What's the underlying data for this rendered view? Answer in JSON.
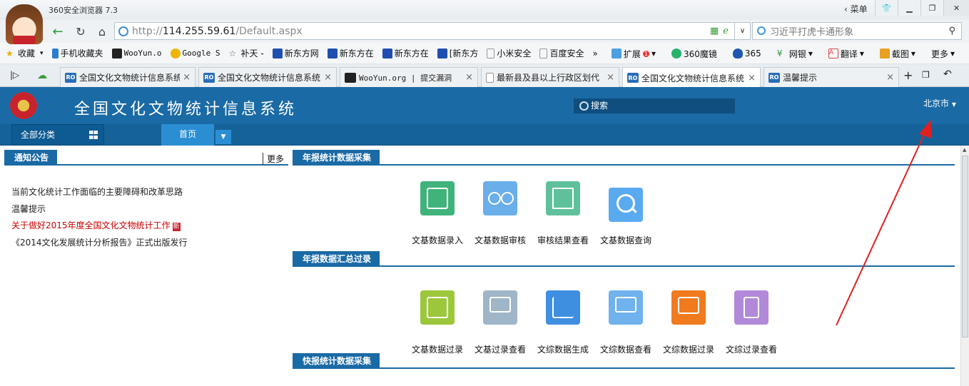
{
  "browser": {
    "app_title": "360安全浏览器 7.3",
    "menu_label": "菜单",
    "url_scheme": "http://",
    "url_host": "114.255.59.61",
    "url_path": "/Default.aspx",
    "search_placeholder": "习近平打虎卡通形象",
    "favorites": [
      {
        "label": "收藏",
        "icon": "star-icon"
      },
      {
        "label": "手机收藏夹",
        "icon": "phone-icon"
      },
      {
        "label": "WooYun.o",
        "icon": "wooyun-icon"
      },
      {
        "label": "Google S",
        "icon": "google-icon"
      },
      {
        "label": "补天 -",
        "icon": "butian-icon"
      },
      {
        "label": "新东方网",
        "icon": "paw-icon"
      },
      {
        "label": "新东方在",
        "icon": "paw-icon"
      },
      {
        "label": "新东方在",
        "icon": "paw-icon"
      },
      {
        "label": "[新东方",
        "icon": "paw-icon"
      },
      {
        "label": "小米安全",
        "icon": "page-icon"
      },
      {
        "label": "百度安全",
        "icon": "page-icon"
      }
    ],
    "toolbar_right": {
      "extensions": "扩展",
      "extensions_badge": "1",
      "magic_mirror": "360魔镜",
      "n365": "365",
      "online_banking": "网银",
      "translate": "翻译",
      "screenshot": "截图",
      "more": "更多"
    },
    "tabs": [
      {
        "title": "全国文化文物统计信息系统",
        "icon": "RO"
      },
      {
        "title": "全国文化文物统计信息系统",
        "icon": "RO"
      },
      {
        "title": "WooYun.org | 提交漏洞",
        "icon": "W"
      },
      {
        "title": "最新县及县以上行政区划代",
        "icon": "doc"
      },
      {
        "title": "全国文化文物统计信息系统",
        "icon": "RO",
        "active": true
      },
      {
        "title": "温馨提示",
        "icon": "RO"
      }
    ]
  },
  "page": {
    "system_title": "全国文化文物统计信息系统",
    "search_label": "搜索",
    "region": "北京市",
    "all_categories": "全部分类",
    "home_tab": "首页"
  },
  "notices": {
    "header": "通知公告",
    "more": "更多",
    "items": [
      {
        "text": "当前文化统计工作面临的主要障碍和改革思路",
        "highlight": false
      },
      {
        "text": "温馨提示",
        "highlight": false
      },
      {
        "text": "关于做好2015年度全国文化文物统计工作",
        "highlight": true,
        "new_badge": "新"
      },
      {
        "text": "《2014文化发展统计分析报告》正式出版发行",
        "highlight": false
      }
    ]
  },
  "sections": [
    {
      "header": "年报统计数据采集",
      "tiles": [
        {
          "label": "文基数据录入",
          "color": "#3fb37a",
          "icon": "edit-icon"
        },
        {
          "label": "文基数据审核",
          "color": "#6aaeea",
          "icon": "glasses-icon"
        },
        {
          "label": "审核结果查看",
          "color": "#5fc19b",
          "icon": "report-search-icon"
        },
        {
          "label": "文基数据查询",
          "color": "#5aaaf0",
          "icon": "magnifier-icon"
        }
      ]
    },
    {
      "header": "年报数据汇总过录",
      "tiles": [
        {
          "label": "文基数据过录",
          "color": "#9cc73a",
          "icon": "chart-area-icon"
        },
        {
          "label": "文基过录查看",
          "color": "#9fb6c9",
          "icon": "monitor-search-icon"
        },
        {
          "label": "文综数据生成",
          "color": "#3f8fe0",
          "icon": "line-chart-icon"
        },
        {
          "label": "文综数据查看",
          "color": "#6fb2ee",
          "icon": "monitor-search-icon"
        },
        {
          "label": "文综数据过录",
          "color": "#f07a1e",
          "icon": "bar-chart-icon"
        },
        {
          "label": "文综过录查看",
          "color": "#b189d8",
          "icon": "doc-search-icon"
        }
      ]
    },
    {
      "header": "快报统计数据采集",
      "tiles": []
    }
  ],
  "colors": {
    "header_blue": "#1a6aa5",
    "nav_blue": "#156299",
    "annotation_red": "#e02020"
  }
}
